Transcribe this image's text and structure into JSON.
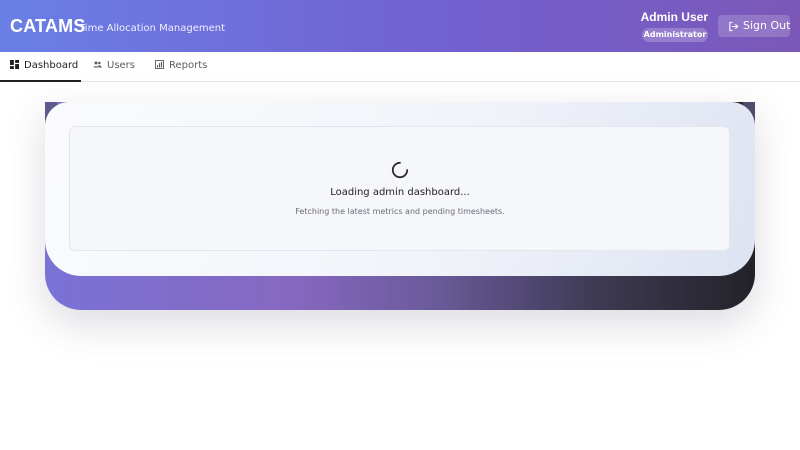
{
  "header": {
    "brand": "CATAMS",
    "subtitle": "Time Allocation Management",
    "user_name": "Admin User",
    "role": "Administrator",
    "signout_label": "Sign Out",
    "signout_icon": "sign-out-icon"
  },
  "tabs": [
    {
      "label": "Dashboard",
      "icon": "dashboard-icon",
      "active": true
    },
    {
      "label": "Users",
      "icon": "users-icon",
      "active": false
    },
    {
      "label": "Reports",
      "icon": "reports-icon",
      "active": false
    }
  ],
  "loading": {
    "title": "Loading admin dashboard...",
    "subtitle": "Fetching the latest metrics and pending timesheets.",
    "icon": "spinner-icon"
  },
  "colors": {
    "header_start": "#6a7fe6",
    "header_end": "#7b58b8",
    "text_dark": "#1f1f24"
  }
}
